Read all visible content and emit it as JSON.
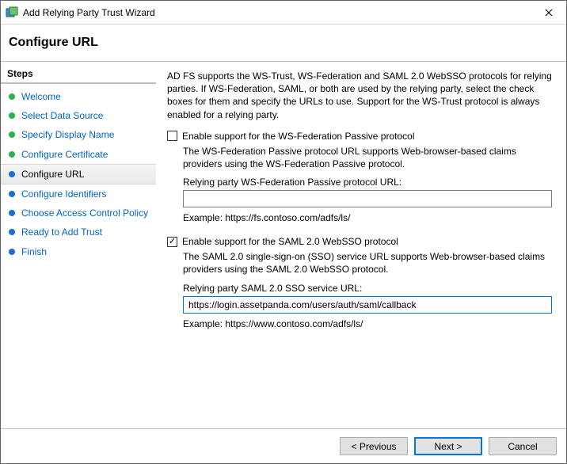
{
  "window": {
    "title": "Add Relying Party Trust Wizard"
  },
  "header": {
    "title": "Configure URL"
  },
  "sidebar": {
    "heading": "Steps",
    "items": [
      {
        "label": "Welcome",
        "state": "done"
      },
      {
        "label": "Select Data Source",
        "state": "done"
      },
      {
        "label": "Specify Display Name",
        "state": "done"
      },
      {
        "label": "Configure Certificate",
        "state": "done"
      },
      {
        "label": "Configure URL",
        "state": "current"
      },
      {
        "label": "Configure Identifiers",
        "state": "pending"
      },
      {
        "label": "Choose Access Control Policy",
        "state": "pending"
      },
      {
        "label": "Ready to Add Trust",
        "state": "pending"
      },
      {
        "label": "Finish",
        "state": "pending"
      }
    ]
  },
  "main": {
    "intro": "AD FS supports the WS-Trust, WS-Federation and SAML 2.0 WebSSO protocols for relying parties.  If WS-Federation, SAML, or both are used by the relying party, select the check boxes for them and specify the URLs to use.  Support for the WS-Trust protocol is always enabled for a relying party.",
    "wsf": {
      "checkbox_label": "Enable support for the WS-Federation Passive protocol",
      "checked": false,
      "desc": "The WS-Federation Passive protocol URL supports Web-browser-based claims providers using the WS-Federation Passive protocol.",
      "field_label": "Relying party WS-Federation Passive protocol URL:",
      "value": "",
      "example": "Example: https://fs.contoso.com/adfs/ls/"
    },
    "saml": {
      "checkbox_label": "Enable support for the SAML 2.0 WebSSO protocol",
      "checked": true,
      "desc": "The SAML 2.0 single-sign-on (SSO) service URL supports Web-browser-based claims providers using the SAML 2.0 WebSSO protocol.",
      "field_label": "Relying party SAML 2.0 SSO service URL:",
      "value": "https://login.assetpanda.com/users/auth/saml/callback",
      "example": "Example: https://www.contoso.com/adfs/ls/"
    }
  },
  "footer": {
    "previous": "< Previous",
    "next": "Next >",
    "cancel": "Cancel"
  }
}
